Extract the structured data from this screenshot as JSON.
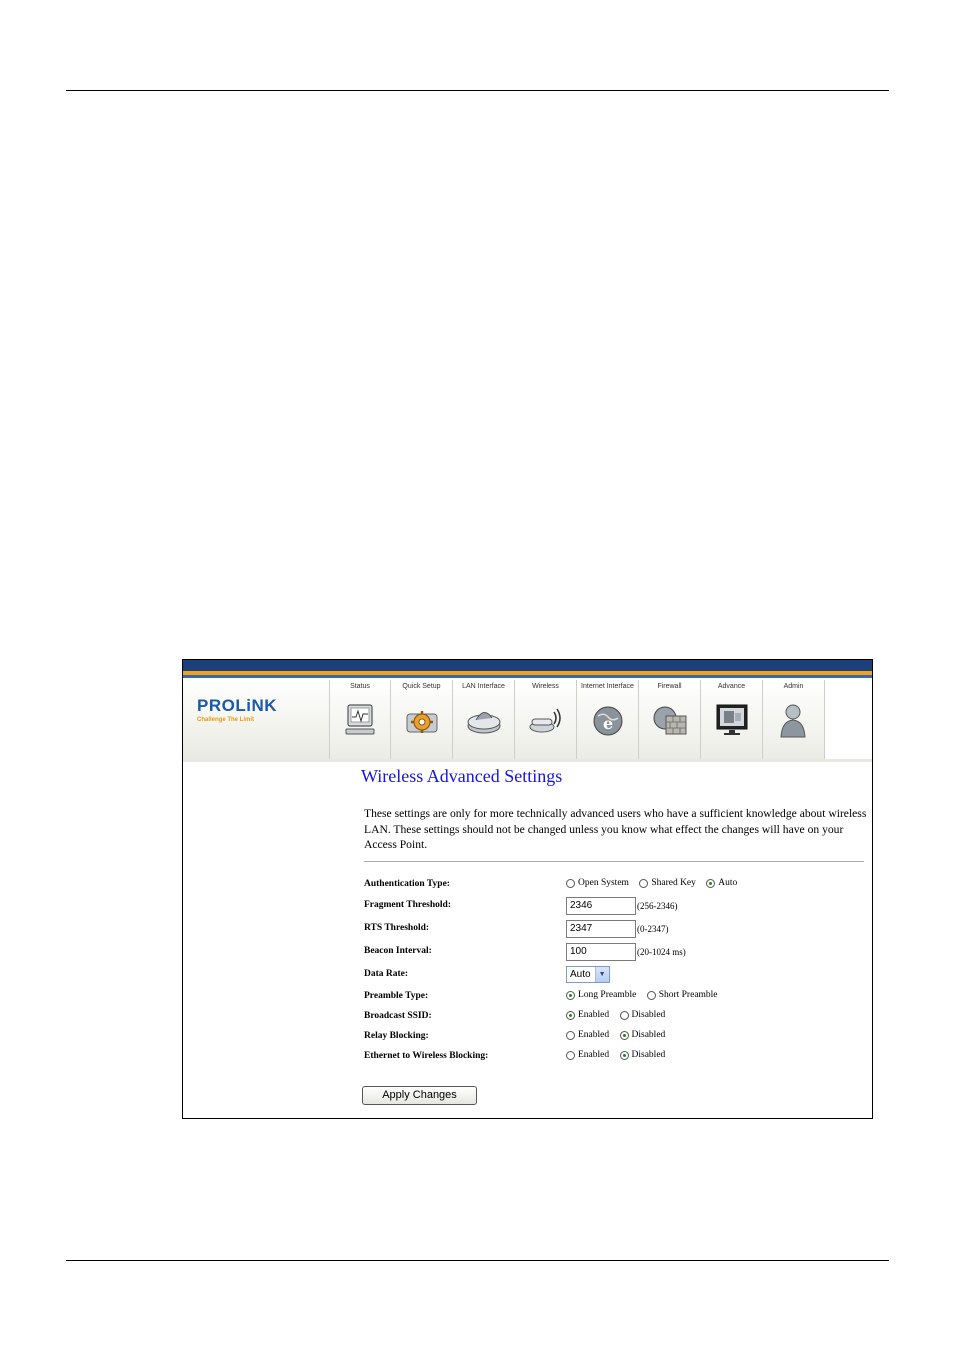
{
  "nav": {
    "items": [
      {
        "label": "Status",
        "icon": "monitor-icon"
      },
      {
        "label": "Quick Setup",
        "icon": "gear-icon"
      },
      {
        "label": "LAN Interface",
        "icon": "router-icon"
      },
      {
        "label": "Wireless",
        "icon": "wireless-icon"
      },
      {
        "label": "Internet Interface",
        "icon": "globe-e-icon"
      },
      {
        "label": "Firewall",
        "icon": "firewall-icon"
      },
      {
        "label": "Advance",
        "icon": "screen-icon"
      },
      {
        "label": "Admin",
        "icon": "user-icon"
      }
    ]
  },
  "logo": {
    "name": "PROLiNK",
    "tagline": "Challenge The Limit"
  },
  "page": {
    "title": "Wireless Advanced Settings",
    "description": "These settings are only for more technically advanced users who have a sufficient knowledge about wireless LAN. These settings should not be changed unless you know what effect the changes will have on your Access Point."
  },
  "form": {
    "auth_type": {
      "label": "Authentication Type:",
      "options": [
        "Open System",
        "Shared Key",
        "Auto"
      ],
      "selected": "Auto"
    },
    "fragment": {
      "label": "Fragment Threshold:",
      "value": "2346",
      "range": "(256-2346)"
    },
    "rts": {
      "label": "RTS Threshold:",
      "value": "2347",
      "range": "(0-2347)"
    },
    "beacon": {
      "label": "Beacon Interval:",
      "value": "100",
      "range": "(20-1024 ms)"
    },
    "data_rate": {
      "label": "Data Rate:",
      "value": "Auto"
    },
    "preamble": {
      "label": "Preamble Type:",
      "options": [
        "Long Preamble",
        "Short Preamble"
      ],
      "selected": "Long Preamble"
    },
    "broadcast_ssid": {
      "label": "Broadcast SSID:",
      "options": [
        "Enabled",
        "Disabled"
      ],
      "selected": "Enabled"
    },
    "relay_blocking": {
      "label": "Relay Blocking:",
      "options": [
        "Enabled",
        "Disabled"
      ],
      "selected": "Disabled"
    },
    "eth_wireless_blocking": {
      "label": "Ethernet to Wireless Blocking:",
      "options": [
        "Enabled",
        "Disabled"
      ],
      "selected": "Disabled"
    },
    "apply_label": "Apply Changes"
  },
  "colors": {
    "title": "#1414e6",
    "header_band": "#1d3f7a",
    "accent_band": "#f0a418",
    "logo": "#1a5aa8"
  }
}
